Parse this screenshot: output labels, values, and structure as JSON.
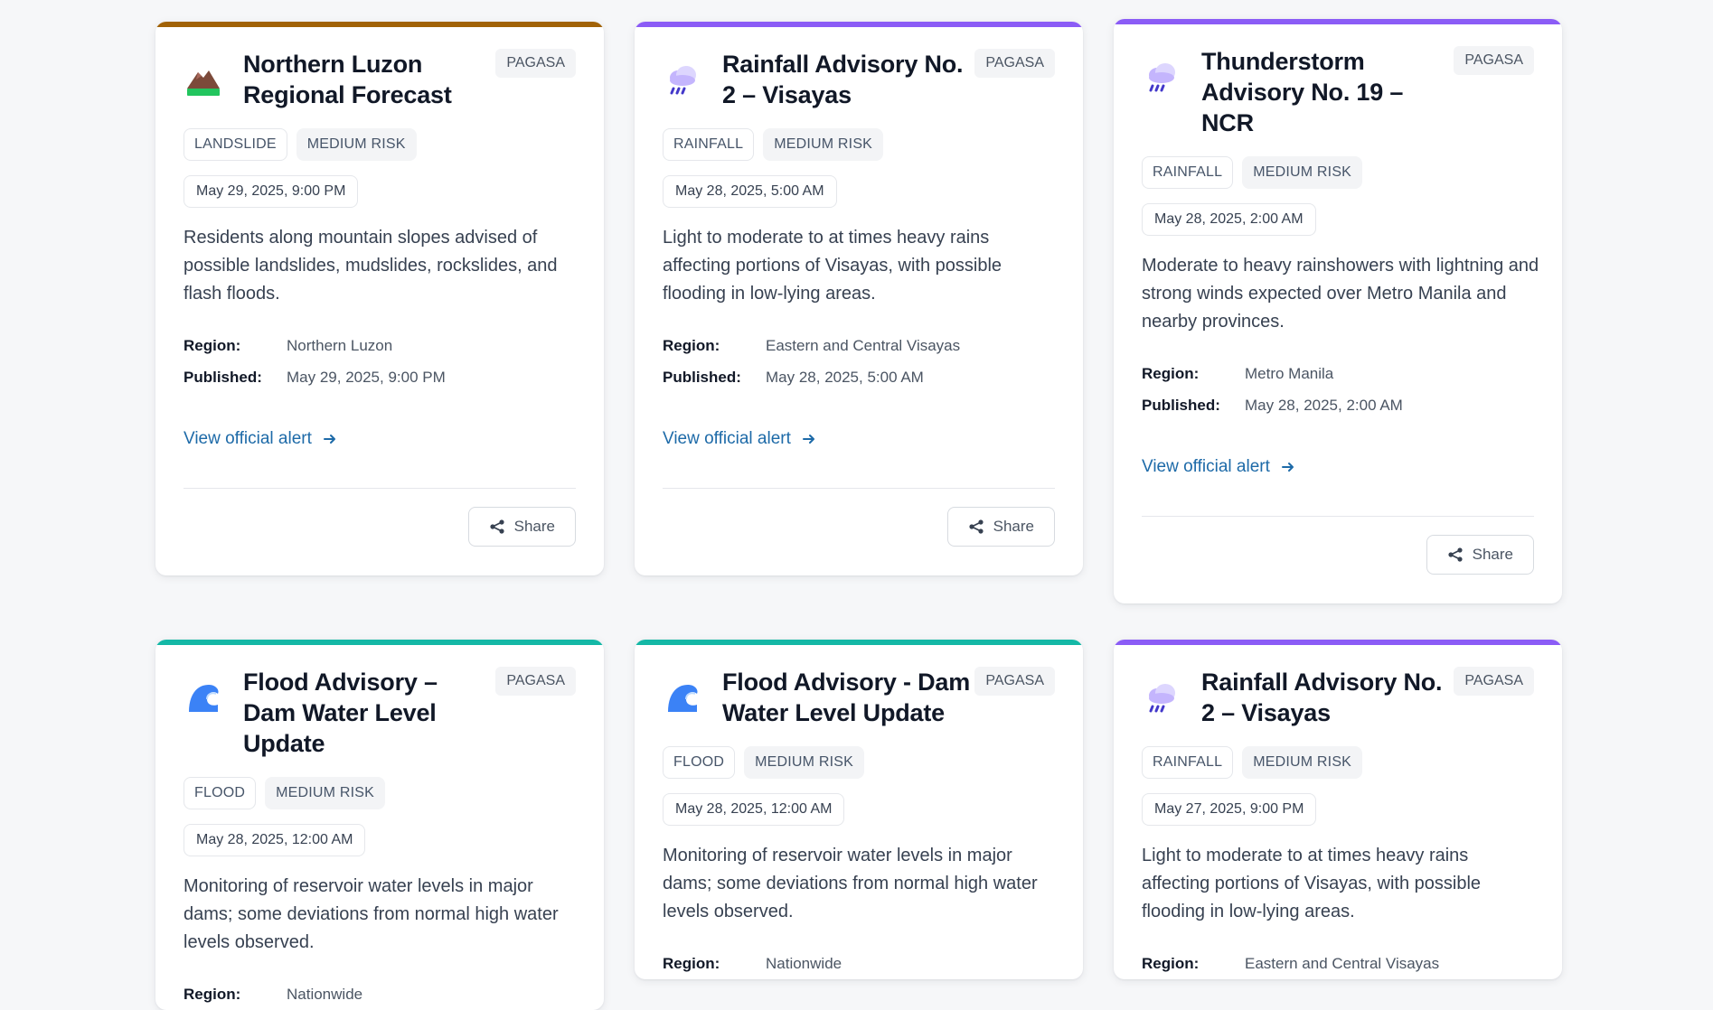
{
  "ui": {
    "view_link_label": "View official alert",
    "share_label": "Share",
    "region_label": "Region:",
    "published_label": "Published:"
  },
  "cards": [
    {
      "title": "Northern Luzon Regional Forecast",
      "source": "PAGASA",
      "type_tag": "LANDSLIDE",
      "risk_tag": "MEDIUM RISK",
      "date": "May 29, 2025, 9:00 PM",
      "description": "Residents along mountain slopes advised of possible landslides, mudslides, rockslides, and flash floods.",
      "region": "Northern Luzon",
      "published": "May 29, 2025, 9:00 PM",
      "accent": "#a16207",
      "icon": "landslide-icon"
    },
    {
      "title": "Rainfall Advisory No. 2 – Visayas",
      "source": "PAGASA",
      "type_tag": "RAINFALL",
      "risk_tag": "MEDIUM RISK",
      "date": "May 28, 2025, 5:00 AM",
      "description": "Light to moderate to at times heavy rains affecting portions of Visayas, with possible flooding in low-lying areas.",
      "region": "Eastern and Central Visayas",
      "published": "May 28, 2025, 5:00 AM",
      "accent": "#8b5cf6",
      "icon": "rain-cloud-icon"
    },
    {
      "title": "Thunderstorm Advisory No. 19 – NCR",
      "source": "PAGASA",
      "type_tag": "RAINFALL",
      "risk_tag": "MEDIUM RISK",
      "date": "May 28, 2025, 2:00 AM",
      "description": "Moderate to heavy rainshowers with lightning and strong winds expected over Metro Manila and nearby provinces.",
      "region": "Metro Manila",
      "published": "May 28, 2025, 2:00 AM",
      "accent": "#8b5cf6",
      "icon": "rain-cloud-icon"
    },
    {
      "title": "Flood Advisory – Dam Water Level Update",
      "source": "PAGASA",
      "type_tag": "FLOOD",
      "risk_tag": "MEDIUM RISK",
      "date": "May 28, 2025, 12:00 AM",
      "description": "Monitoring of reservoir water levels in major dams; some deviations from normal high water levels observed.",
      "region": "Nationwide",
      "published": "",
      "accent": "#14b8a6",
      "icon": "wave-icon"
    },
    {
      "title": "Flood Advisory - Dam Water Level Update",
      "source": "PAGASA",
      "type_tag": "FLOOD",
      "risk_tag": "MEDIUM RISK",
      "date": "May 28, 2025, 12:00 AM",
      "description": "Monitoring of reservoir water levels in major dams; some deviations from normal high water levels observed.",
      "region": "Nationwide",
      "published": "",
      "accent": "#14b8a6",
      "icon": "wave-icon"
    },
    {
      "title": "Rainfall Advisory No. 2 – Visayas",
      "source": "PAGASA",
      "type_tag": "RAINFALL",
      "risk_tag": "MEDIUM RISK",
      "date": "May 27, 2025, 9:00 PM",
      "description": "Light to moderate to at times heavy rains affecting portions of Visayas, with possible flooding in low-lying areas.",
      "region": "Eastern and Central Visayas",
      "published": "",
      "accent": "#8b5cf6",
      "icon": "rain-cloud-icon"
    }
  ]
}
